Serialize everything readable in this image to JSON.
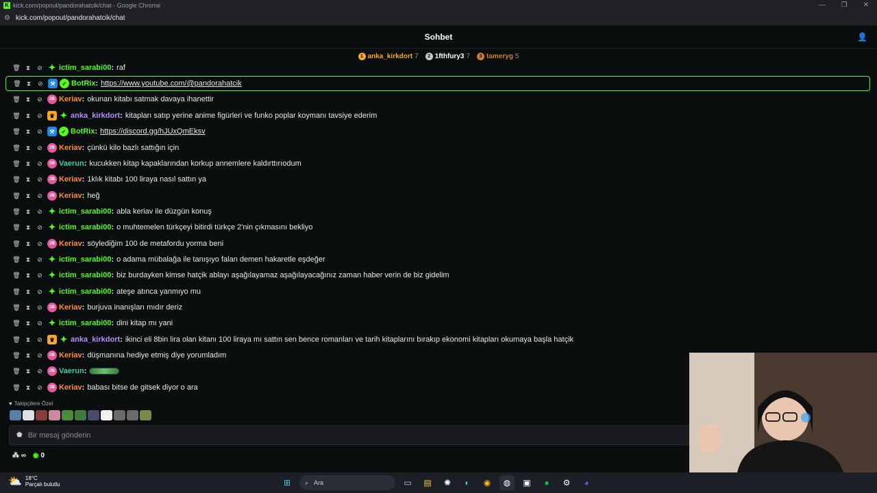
{
  "window": {
    "title": "kick.com/popout/pandorahatcik/chat - Google Chrome",
    "url": "kick.com/popout/pandorahatcik/chat",
    "controls": [
      "—",
      "❐",
      "✕"
    ]
  },
  "header": {
    "title": "Sohbet"
  },
  "leaderboard": [
    {
      "rank": "1",
      "name": "anka_kirkdort",
      "count": "7",
      "color": "#f5a623"
    },
    {
      "rank": "2",
      "name": "1fthfury3",
      "count": "7",
      "color": "#c9c9c9"
    },
    {
      "rank": "3",
      "name": "tameryg",
      "count": "5",
      "color": "#cd7f32"
    }
  ],
  "messages": [
    {
      "user": "ictim_sarabi00",
      "color": "#53fc18",
      "badges": [
        "gift"
      ],
      "text": "raf"
    },
    {
      "user": "BotRix",
      "color": "#53fc18",
      "badges": [
        "bot",
        "verified"
      ],
      "text": "https://www.youtube.com/@pandorahatcik",
      "link": true,
      "pinned": true
    },
    {
      "user": "Keriav",
      "color": "#ff8c3a",
      "badges": [
        "sub"
      ],
      "text": "okunan kitabı satmak davaya ihanettir"
    },
    {
      "user": "anka_kirkdort",
      "color": "#b78cff",
      "badges": [
        "crown",
        "gift"
      ],
      "text": "kitapları satıp yerine anime figürleri ve funko poplar koymanı tavsiye ederim"
    },
    {
      "user": "BotRix",
      "color": "#53fc18",
      "badges": [
        "bot",
        "verified"
      ],
      "text": "https://discord.gg/hJUxQmEksv",
      "link": true
    },
    {
      "user": "Keriav",
      "color": "#ff8c3a",
      "badges": [
        "sub"
      ],
      "text": "çünkü kilo bazlı sattığın için"
    },
    {
      "user": "Vaerun",
      "color": "#3ad1a0",
      "badges": [
        "sub"
      ],
      "text": "kucukken kitap kapaklarından korkup annemlere kaldırttırıodum"
    },
    {
      "user": "Keriav",
      "color": "#ff8c3a",
      "badges": [
        "sub"
      ],
      "text": "1klık kitabı 100 liraya nasıl sattın ya"
    },
    {
      "user": "Keriav",
      "color": "#ff8c3a",
      "badges": [
        "sub"
      ],
      "text": "heğ"
    },
    {
      "user": "ictim_sarabi00",
      "color": "#53fc18",
      "badges": [
        "gift"
      ],
      "text": "abla keriav ile düzgün konuş"
    },
    {
      "user": "ictim_sarabi00",
      "color": "#53fc18",
      "badges": [
        "gift"
      ],
      "text": "o muhtemelen türkçeyi bitirdi türkçe 2'nin çıkmasını bekliyo"
    },
    {
      "user": "Keriav",
      "color": "#ff8c3a",
      "badges": [
        "sub"
      ],
      "text": "söylediğim 100 de metafordu yorma beni"
    },
    {
      "user": "ictim_sarabi00",
      "color": "#53fc18",
      "badges": [
        "gift"
      ],
      "text": "o adama mübalağa ile tanışıyo falan demen hakaretle eşdeğer"
    },
    {
      "user": "ictim_sarabi00",
      "color": "#53fc18",
      "badges": [
        "gift"
      ],
      "text": "biz burdayken kimse hatçik ablayı aşağılayamaz aşağılayacağınız zaman haber verin de biz gidelim"
    },
    {
      "user": "ictim_sarabi00",
      "color": "#53fc18",
      "badges": [
        "gift"
      ],
      "text": "ateşe atınca yanmıyo mu"
    },
    {
      "user": "Keriav",
      "color": "#ff8c3a",
      "badges": [
        "sub"
      ],
      "text": "burjuva inanışları mıdır deriz"
    },
    {
      "user": "ictim_sarabi00",
      "color": "#53fc18",
      "badges": [
        "gift"
      ],
      "text": "dini kitap mı yani"
    },
    {
      "user": "anka_kirkdort",
      "color": "#b78cff",
      "badges": [
        "crown",
        "gift"
      ],
      "text": "ikinci eli 8bin lira olan kitanı 100 liraya mı sattın sen bence romanları ve tarih kitaplarını bırakıp ekonomi kitapları okumaya başla hatçik"
    },
    {
      "user": "Keriav",
      "color": "#ff8c3a",
      "badges": [
        "sub"
      ],
      "text": "düşmanına hediye etmiş diye yorumladım"
    },
    {
      "user": "Vaerun",
      "color": "#3ad1a0",
      "badges": [
        "sub"
      ],
      "text": "",
      "emote": true
    },
    {
      "user": "Keriav",
      "color": "#ff8c3a",
      "badges": [
        "sub"
      ],
      "text": "babası bitse de gitsek diyor o ara"
    }
  ],
  "followers_only": {
    "label": "Takipçilere Özel"
  },
  "emote_colors": [
    "#5a7ea8",
    "#e0e0e0",
    "#8a3b3b",
    "#c98aa0",
    "#4f8a3a",
    "#3f7a3f",
    "#4a4a6a",
    "#f0f0f0",
    "#6a6a6a",
    "#6a6a6a",
    "#7a8a4a"
  ],
  "input": {
    "placeholder": "Bir mesaj gönderin"
  },
  "footer": {
    "infinity": "∞",
    "points": "0"
  },
  "taskbar": {
    "temp": "18°C",
    "weather": "Parçalı bulutlu",
    "search": "Ara"
  }
}
